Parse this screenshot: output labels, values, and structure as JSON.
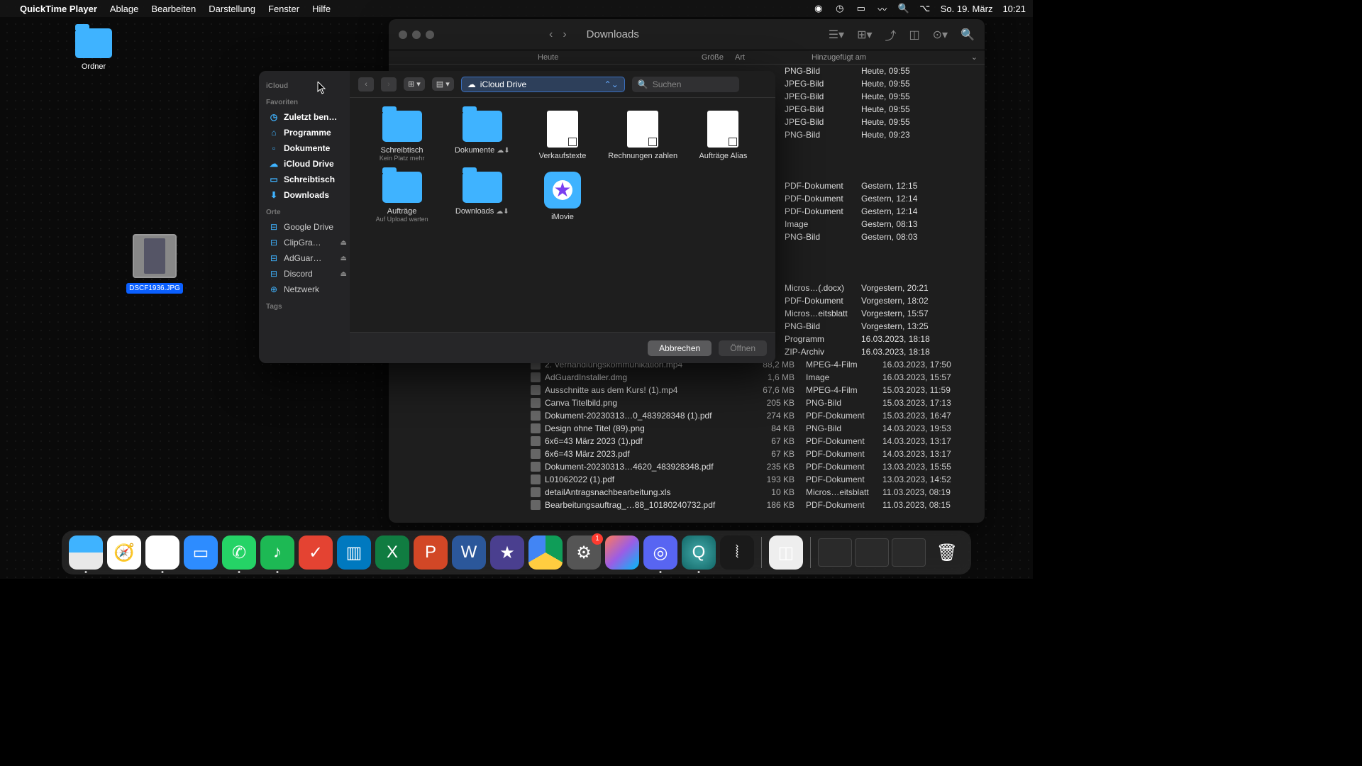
{
  "menubar": {
    "app_name": "QuickTime Player",
    "menus": [
      "Ablage",
      "Bearbeiten",
      "Darstellung",
      "Fenster",
      "Hilfe"
    ],
    "date": "So. 19. März",
    "time": "10:21"
  },
  "desktop": {
    "folder_label": "Ordner",
    "file_label": "DSCF1936.JPG"
  },
  "finder": {
    "title": "Downloads",
    "sidebar_label": "iCloud",
    "columns": {
      "name": "Heute",
      "size": "Größe",
      "kind": "Art",
      "date": "Hinzugefügt am"
    },
    "peek_rows": [
      {
        "kind": "PNG-Bild",
        "date": "Heute, 09:55"
      },
      {
        "kind": "JPEG-Bild",
        "date": "Heute, 09:55"
      },
      {
        "kind": "JPEG-Bild",
        "date": "Heute, 09:55"
      },
      {
        "kind": "JPEG-Bild",
        "date": "Heute, 09:55"
      },
      {
        "kind": "JPEG-Bild",
        "date": "Heute, 09:55"
      },
      {
        "kind": "PNG-Bild",
        "date": "Heute, 09:23"
      },
      {
        "kind": "",
        "date": ""
      },
      {
        "kind": "",
        "date": ""
      },
      {
        "kind": "",
        "date": ""
      },
      {
        "kind": "PDF-Dokument",
        "date": "Gestern, 12:15"
      },
      {
        "kind": "PDF-Dokument",
        "date": "Gestern, 12:14"
      },
      {
        "kind": "PDF-Dokument",
        "date": "Gestern, 12:14"
      },
      {
        "kind": "Image",
        "date": "Gestern, 08:13"
      },
      {
        "kind": "PNG-Bild",
        "date": "Gestern, 08:03"
      },
      {
        "kind": "",
        "date": ""
      },
      {
        "kind": "",
        "date": ""
      },
      {
        "kind": "",
        "date": ""
      },
      {
        "kind": "Micros…(.docx)",
        "date": "Vorgestern, 20:21"
      },
      {
        "kind": "PDF-Dokument",
        "date": "Vorgestern, 18:02"
      },
      {
        "kind": "Micros…eitsblatt",
        "date": "Vorgestern, 15:57"
      },
      {
        "kind": "PNG-Bild",
        "date": "Vorgestern, 13:25"
      },
      {
        "kind": "Programm",
        "date": "16.03.2023, 18:18"
      },
      {
        "kind": "ZIP-Archiv",
        "date": "16.03.2023, 18:18"
      }
    ],
    "full_rows": [
      {
        "name": "2. Verhandlungskommunikation.mp4",
        "size": "88,2 MB",
        "kind": "MPEG-4-Film",
        "date": "16.03.2023, 17:50"
      },
      {
        "name": "AdGuardInstaller.dmg",
        "size": "1,6 MB",
        "kind": "Image",
        "date": "16.03.2023, 15:57"
      },
      {
        "name": "Ausschnitte aus dem Kurs! (1).mp4",
        "size": "67,6 MB",
        "kind": "MPEG-4-Film",
        "date": "15.03.2023, 11:59"
      },
      {
        "name": "Canva Titelbild.png",
        "size": "205 KB",
        "kind": "PNG-Bild",
        "date": "15.03.2023, 17:13"
      },
      {
        "name": "Dokument-20230313…0_483928348 (1).pdf",
        "size": "274 KB",
        "kind": "PDF-Dokument",
        "date": "15.03.2023, 16:47"
      },
      {
        "name": "Design ohne Titel (89).png",
        "size": "84 KB",
        "kind": "PNG-Bild",
        "date": "14.03.2023, 19:53"
      },
      {
        "name": "6x6=43 März 2023 (1).pdf",
        "size": "67 KB",
        "kind": "PDF-Dokument",
        "date": "14.03.2023, 13:17"
      },
      {
        "name": "6x6=43 März 2023.pdf",
        "size": "67 KB",
        "kind": "PDF-Dokument",
        "date": "14.03.2023, 13:17"
      },
      {
        "name": "Dokument-20230313…4620_483928348.pdf",
        "size": "235 KB",
        "kind": "PDF-Dokument",
        "date": "13.03.2023, 15:55"
      },
      {
        "name": "L01062022 (1).pdf",
        "size": "193 KB",
        "kind": "PDF-Dokument",
        "date": "13.03.2023, 14:52"
      },
      {
        "name": "detailAntragsnachbearbeitung.xls",
        "size": "10 KB",
        "kind": "Micros…eitsblatt",
        "date": "11.03.2023, 08:19"
      },
      {
        "name": "Bearbeitungsauftrag_…88_10180240732.pdf",
        "size": "186 KB",
        "kind": "PDF-Dokument",
        "date": "11.03.2023, 08:15"
      }
    ]
  },
  "open_dialog": {
    "sidebar": {
      "icloud_label": "iCloud",
      "favoriten": "Favoriten",
      "items_fav": [
        "Zuletzt ben…",
        "Programme",
        "Dokumente",
        "iCloud Drive",
        "Schreibtisch",
        "Downloads"
      ],
      "orte": "Orte",
      "items_orte": [
        "Google Drive",
        "ClipGra…",
        "AdGuar…",
        "Discord",
        "Netzwerk"
      ],
      "tags": "Tags"
    },
    "location": "iCloud Drive",
    "search_placeholder": "Suchen",
    "icons": [
      {
        "type": "folder",
        "label": "Schreibtisch",
        "sub": "Kein Platz mehr"
      },
      {
        "type": "folder",
        "label": "Dokumente",
        "cloud": true
      },
      {
        "type": "doc",
        "label": "Verkaufstexte"
      },
      {
        "type": "doc",
        "label": "Rechnungen zahlen"
      },
      {
        "type": "doc",
        "label": "Aufträge Alias"
      },
      {
        "type": "folder",
        "label": "Aufträge",
        "sub": "Auf Upload warten"
      },
      {
        "type": "folder",
        "label": "Downloads",
        "cloud": true
      },
      {
        "type": "app",
        "label": "iMovie"
      }
    ],
    "cancel": "Abbrechen",
    "open": "Öffnen"
  },
  "dock": {
    "badge_settings": "1"
  }
}
